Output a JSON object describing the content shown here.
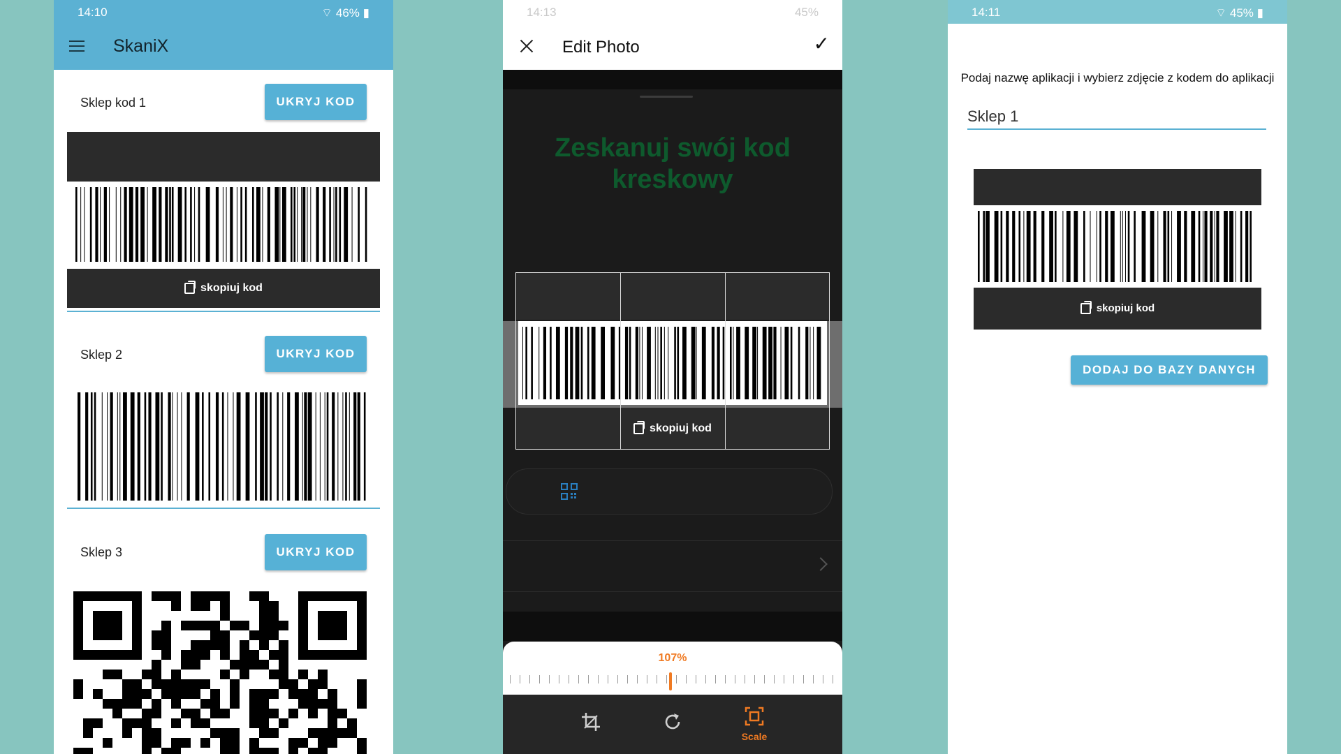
{
  "colors": {
    "background": "#87c5bf",
    "app_bar": "#5bb1d3",
    "button": "#56b1d6",
    "accent_orange": "#f07a22",
    "scan_title_green": "#0e5a2d"
  },
  "phone1": {
    "status": {
      "time": "14:10",
      "battery": "46%",
      "icons": [
        "usb-icon",
        "wifi-icon",
        "signal-icon",
        "battery-icon"
      ]
    },
    "app_title": "SkaniX",
    "cards": [
      {
        "label": "Sklep kod 1",
        "button": "UKRYJ KOD",
        "copy_label": "skopiuj kod",
        "code_type": "barcode"
      },
      {
        "label": "Sklep 2",
        "button": "UKRYJ KOD",
        "code_type": "barcode"
      },
      {
        "label": "Sklep 3",
        "button": "UKRYJ KOD",
        "code_type": "qr"
      }
    ]
  },
  "phone2": {
    "status": {
      "time": "14:13",
      "battery": "45%"
    },
    "header_title": "Edit Photo",
    "scan_title": "Zeskanuj swój kod kreskowy",
    "copy_label": "skopiuj kod",
    "zoom": "107%",
    "tools": [
      {
        "name": "crop",
        "label": ""
      },
      {
        "name": "rotate",
        "label": ""
      },
      {
        "name": "scale",
        "label": "Scale"
      }
    ]
  },
  "phone3": {
    "status": {
      "time": "14:11",
      "battery": "45%"
    },
    "instruction": "Podaj nazwę aplikacji i wybierz zdjęcie z kodem do aplikacji",
    "name_value": "Sklep 1",
    "copy_label": "skopiuj kod",
    "add_button": "DODAJ DO BAZY DANYCH"
  }
}
